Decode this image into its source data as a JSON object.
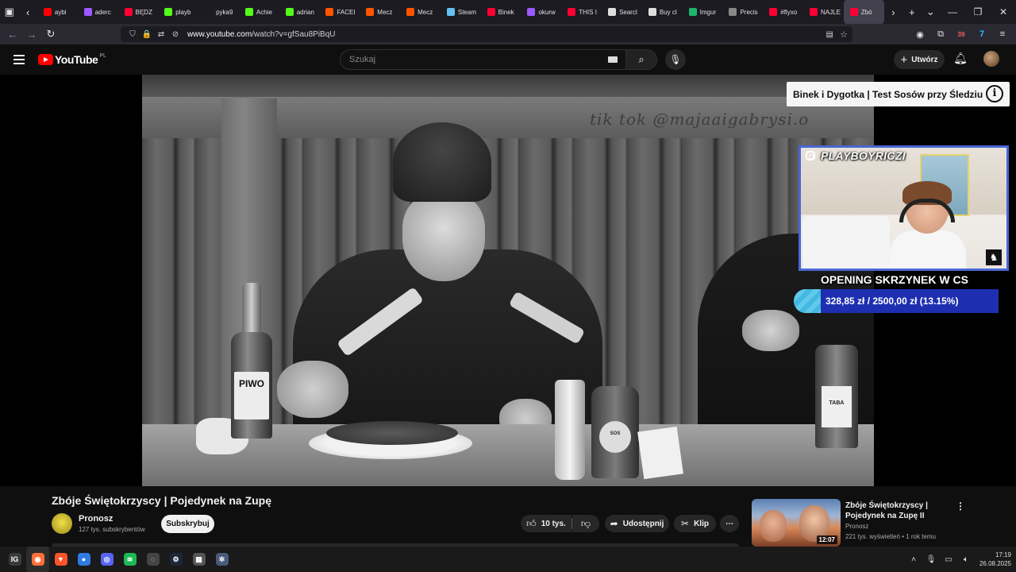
{
  "browser": {
    "tabs": [
      {
        "label": "aybi",
        "color": "#ff0000"
      },
      {
        "label": "aderc",
        "color": "#9b59ff"
      },
      {
        "label": "BĘDZ",
        "color": "#ff0033"
      },
      {
        "label": "playb",
        "color": "#53fc18"
      },
      {
        "label": "pyka9",
        "color": "#1c1b22"
      },
      {
        "label": "Achie",
        "color": "#53fc18"
      },
      {
        "label": "adrian",
        "color": "#53fc18"
      },
      {
        "label": "FACEI",
        "color": "#ff5500"
      },
      {
        "label": "Mecz",
        "color": "#ff5500"
      },
      {
        "label": "Mecz",
        "color": "#ff5500"
      },
      {
        "label": "Steam",
        "color": "#66c0f4"
      },
      {
        "label": "Binek",
        "color": "#ff0033"
      },
      {
        "label": "okurw",
        "color": "#9b59ff"
      },
      {
        "label": "THIS I",
        "color": "#ff0033"
      },
      {
        "label": "Searcl",
        "color": "#dddddd"
      },
      {
        "label": "Buy cl",
        "color": "#dddddd"
      },
      {
        "label": "Imgur",
        "color": "#1bb76e"
      },
      {
        "label": "Precis",
        "color": "#888888"
      },
      {
        "label": "#flyxo",
        "color": "#ff0033"
      },
      {
        "label": "NAJLE",
        "color": "#ff0033"
      },
      {
        "label": "Zbó",
        "color": "#ff0033"
      }
    ],
    "url_host": "www.youtube.com",
    "url_path": "/watch?v=gfSau8PiBqU",
    "ext_badge": "39"
  },
  "youtube": {
    "logo_text": "YouTube",
    "country": "PL",
    "search_placeholder": "Szukaj",
    "create_label": "Utwórz"
  },
  "overlay": {
    "info_card_title": "Binek i Dygotka | Test Sosów przy Śledziu",
    "cam_handle": "PLAYBOYRICZI",
    "goal_title": "OPENING SKRZYNEK W CS",
    "goal_text": "328,85 zł / 2500,00 zł (13.15%)",
    "goal_fraction": 0.1315
  },
  "video": {
    "title": "Zbóje Świętokrzyscy | Pojedynek na Zupę",
    "bottle_label": "PIWO",
    "sauce_label": "SOS",
    "sauce3_label": "TABA",
    "graffiti_text": "tik tok @majaaigabrysi.o",
    "channel_name": "Pronosz",
    "channel_subs": "127 tys. subskrybentów",
    "subscribe_label": "Subskrybuj",
    "likes": "10 tys.",
    "share_label": "Udostępnij",
    "clip_label": "Klip",
    "more_label": "⋯"
  },
  "recommended": {
    "title": "Zbóje Świętokrzyscy | Pojedynek na Zupę II",
    "channel": "Pronosz",
    "stats": "221 tys. wyświetleń • 1 rok temu",
    "duration": "12:07"
  },
  "taskbar": {
    "items": [
      {
        "name": "tb-app-logo",
        "glyph": "IG",
        "color": "#3a3a3a"
      },
      {
        "name": "tb-firefox",
        "glyph": "◉",
        "color": "#ff7139"
      },
      {
        "name": "tb-brave",
        "glyph": "▼",
        "color": "#fb542b"
      },
      {
        "name": "tb-app-blue",
        "glyph": "●",
        "color": "#2f7be2"
      },
      {
        "name": "tb-discord",
        "glyph": "◎",
        "color": "#5865f2"
      },
      {
        "name": "tb-spotify",
        "glyph": "≋",
        "color": "#1db954"
      },
      {
        "name": "tb-app-ring",
        "glyph": "◌",
        "color": "#444444"
      },
      {
        "name": "tb-steam",
        "glyph": "⚙",
        "color": "#1b2838"
      },
      {
        "name": "tb-calc",
        "glyph": "▦",
        "color": "#555555"
      },
      {
        "name": "tb-settings",
        "glyph": "✲",
        "color": "#4a5a7a"
      }
    ],
    "time": "17:19",
    "date": "26.08.2025"
  }
}
